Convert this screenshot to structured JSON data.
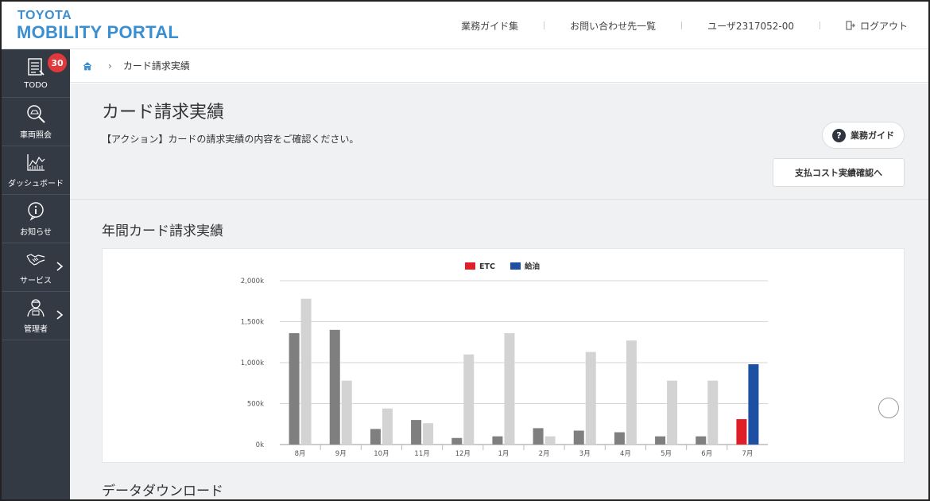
{
  "header": {
    "logo_line1": "TOYOTA",
    "logo_line2": "MOBILITY PORTAL",
    "nav_guides": "業務ガイド集",
    "nav_contacts": "お問い合わせ先一覧",
    "user": "ユーザ2317052-00",
    "logout": "ログアウト"
  },
  "sidebar": {
    "items": [
      {
        "label": "TODO",
        "icon": "todo-list-icon",
        "badge": "30"
      },
      {
        "label": "車両照会",
        "icon": "vehicle-search-icon"
      },
      {
        "label": "ダッシュボード",
        "icon": "dashboard-chart-icon"
      },
      {
        "label": "お知らせ",
        "icon": "info-icon"
      },
      {
        "label": "サービス",
        "icon": "handshake-icon",
        "has_submenu": true
      },
      {
        "label": "管理者",
        "icon": "admin-user-icon",
        "has_submenu": true
      }
    ]
  },
  "breadcrumb": {
    "home_icon": "home-icon",
    "current": "カード請求実績"
  },
  "main": {
    "title": "カード請求実績",
    "description": "【アクション】カードの請求実績の内容をご確認ください。",
    "guide_button": "業務ガイド",
    "guide_icon_glyph": "?",
    "cost_button": "支払コスト実績確認へ",
    "chart_section_title": "年間カード請求実績",
    "download_section_title": "データダウンロード"
  },
  "colors": {
    "accent": "#3b8fd0",
    "sidebar": "#333a44",
    "badge": "#e0383b",
    "etc": "#e01e27",
    "fuel": "#1d4fa3",
    "bar_dark": "#7f7f7f",
    "bar_light": "#d3d3d3"
  },
  "chart_data": {
    "type": "bar",
    "categories": [
      "8月",
      "9月",
      "10月",
      "11月",
      "12月",
      "1月",
      "2月",
      "3月",
      "4月",
      "5月",
      "6月",
      "7月"
    ],
    "series": [
      {
        "name": "ETC",
        "values": [
          1360,
          1400,
          190,
          300,
          80,
          100,
          200,
          170,
          150,
          100,
          100,
          310
        ]
      },
      {
        "name": "給油",
        "values": [
          1780,
          780,
          440,
          260,
          1100,
          1360,
          100,
          1130,
          1270,
          780,
          780,
          980
        ]
      }
    ],
    "y_ticks": [
      "0k",
      "500k",
      "1,000k",
      "1,500k",
      "2,000k"
    ],
    "ylim": [
      0,
      2000
    ],
    "legend_placement": "top-center",
    "highlight_last_category": true,
    "grid": true
  }
}
